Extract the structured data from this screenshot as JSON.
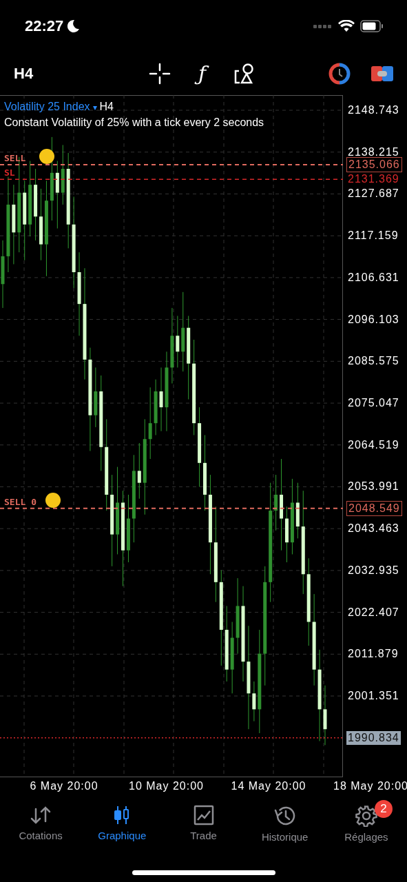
{
  "status_bar": {
    "time": "22:27"
  },
  "toolbar": {
    "timeframe": "H4",
    "function_glyph": "ƒ"
  },
  "chart": {
    "symbol": "Volatility 25 Index",
    "dropdown_glyph": "▾",
    "timeframe": "H4",
    "description": "Constant Volatility of 25% with a tick every 2 seconds",
    "price_tags": [
      {
        "text": "2135.066",
        "kind": "order"
      },
      {
        "text": "2131.369",
        "kind": "stop"
      },
      {
        "text": "2048.549",
        "kind": "order"
      },
      {
        "text": "1990.834",
        "kind": "current"
      }
    ],
    "order_lines": [
      {
        "label": "SELL",
        "kind": "order"
      },
      {
        "label": "SL",
        "kind": "stop"
      },
      {
        "label": "SELL 0",
        "kind": "order"
      }
    ],
    "time_labels": [
      "6 May 20:00",
      "10 May 20:00",
      "14 May 20:00",
      "18 May 20:00"
    ],
    "chart_data": {
      "type": "candlestick",
      "categories": [
        null,
        null,
        null,
        null,
        null,
        null,
        null,
        null,
        null,
        null,
        null,
        null,
        null,
        null,
        null,
        null,
        null,
        null,
        null,
        null,
        null,
        null,
        null,
        null,
        null,
        null,
        null,
        null,
        null,
        null,
        null,
        null,
        null,
        null,
        null,
        null,
        null,
        null,
        null,
        null,
        null,
        null,
        null,
        null,
        null,
        null,
        null,
        null,
        null,
        null,
        null,
        null,
        null,
        null,
        null,
        null,
        null,
        null,
        null,
        null
      ],
      "ylim": [
        1980.9,
        2152.56
      ],
      "grid": true,
      "yticks": [
        {
          "value": 2148.743,
          "label": "2148.743"
        },
        {
          "value": 2138.215,
          "label": "2138.215"
        },
        {
          "value": 2127.687,
          "label": "2127.687"
        },
        {
          "value": 2117.159,
          "label": "2117.159"
        },
        {
          "value": 2106.631,
          "label": "2106.631"
        },
        {
          "value": 2096.103,
          "label": "2096.103"
        },
        {
          "value": 2085.575,
          "label": "2085.575"
        },
        {
          "value": 2075.047,
          "label": "2075.047"
        },
        {
          "value": 2064.519,
          "label": "2064.519"
        },
        {
          "value": 2053.991,
          "label": "2053.991"
        },
        {
          "value": 2043.463,
          "label": "2043.463"
        },
        {
          "value": 2032.935,
          "label": "2032.935"
        },
        {
          "value": 2022.407,
          "label": "2022.407"
        },
        {
          "value": 2011.879,
          "label": "2011.879"
        },
        {
          "value": 2001.351,
          "label": "2001.351"
        }
      ],
      "ohlc": [
        [
          2105,
          2116,
          2099,
          2112
        ],
        [
          2112,
          2132,
          2108,
          2125
        ],
        [
          2125,
          2130,
          2110,
          2118
        ],
        [
          2118,
          2137,
          2113,
          2128
        ],
        [
          2128,
          2131,
          2111,
          2120
        ],
        [
          2120,
          2136,
          2117,
          2130
        ],
        [
          2130,
          2134,
          2116,
          2122
        ],
        [
          2122,
          2129,
          2111,
          2115
        ],
        [
          2115,
          2131,
          2107,
          2126
        ],
        [
          2126,
          2142,
          2121,
          2133
        ],
        [
          2133,
          2136,
          2119,
          2128
        ],
        [
          2128,
          2140,
          2125,
          2134
        ],
        [
          2134,
          2138,
          2114,
          2120
        ],
        [
          2120,
          2127,
          2104,
          2108
        ],
        [
          2108,
          2113,
          2092,
          2100
        ],
        [
          2100,
          2109,
          2081,
          2086
        ],
        [
          2086,
          2089,
          2063,
          2072
        ],
        [
          2072,
          2084,
          2069,
          2078
        ],
        [
          2078,
          2082,
          2058,
          2064
        ],
        [
          2064,
          2071,
          2048,
          2052
        ],
        [
          2052,
          2057,
          2034,
          2042
        ],
        [
          2042,
          2059,
          2037,
          2050
        ],
        [
          2050,
          2053,
          2029,
          2038
        ],
        [
          2038,
          2052,
          2035,
          2046
        ],
        [
          2046,
          2062,
          2040,
          2058
        ],
        [
          2058,
          2065,
          2051,
          2055
        ],
        [
          2055,
          2071,
          2047,
          2066
        ],
        [
          2066,
          2079,
          2061,
          2070
        ],
        [
          2070,
          2081,
          2067,
          2078
        ],
        [
          2078,
          2084,
          2068,
          2074
        ],
        [
          2074,
          2088,
          2068,
          2084
        ],
        [
          2084,
          2099,
          2080,
          2092
        ],
        [
          2092,
          2097,
          2084,
          2088
        ],
        [
          2088,
          2103,
          2083,
          2094
        ],
        [
          2094,
          2097,
          2076,
          2085
        ],
        [
          2085,
          2091,
          2067,
          2070
        ],
        [
          2070,
          2074,
          2054,
          2060
        ],
        [
          2060,
          2067,
          2048,
          2052
        ],
        [
          2052,
          2057,
          2032,
          2040
        ],
        [
          2040,
          2049,
          2025,
          2030
        ],
        [
          2030,
          2033,
          2009,
          2018
        ],
        [
          2018,
          2024,
          2005,
          2008
        ],
        [
          2008,
          2020,
          2002,
          2016
        ],
        [
          2016,
          2031,
          2012,
          2024
        ],
        [
          2024,
          2029,
          2005,
          2010
        ],
        [
          2010,
          2019,
          1993,
          2002
        ],
        [
          2002,
          2005,
          1995,
          1998
        ],
        [
          1998,
          2018,
          1992,
          2012
        ],
        [
          2012,
          2034,
          2004,
          2030
        ],
        [
          2030,
          2055,
          2025,
          2048
        ],
        [
          2048,
          2057,
          2043,
          2052
        ],
        [
          2052,
          2061,
          2038,
          2046
        ],
        [
          2046,
          2049,
          2035,
          2040
        ],
        [
          2040,
          2056,
          2037,
          2050
        ],
        [
          2050,
          2055,
          2041,
          2044
        ],
        [
          2044,
          2053,
          2027,
          2032
        ],
        [
          2032,
          2036,
          2014,
          2020
        ],
        [
          2020,
          2027,
          2004,
          2008
        ],
        [
          2008,
          2013,
          1990,
          1998
        ],
        [
          1998,
          2004,
          1989,
          1993
        ]
      ]
    }
  },
  "tab_bar": {
    "tabs": [
      {
        "label": "Cotations",
        "selected": false
      },
      {
        "label": "Graphique",
        "selected": true
      },
      {
        "label": "Trade",
        "selected": false
      },
      {
        "label": "Historique",
        "selected": false
      },
      {
        "label": "Réglages",
        "selected": false,
        "badge": "2"
      }
    ]
  }
}
